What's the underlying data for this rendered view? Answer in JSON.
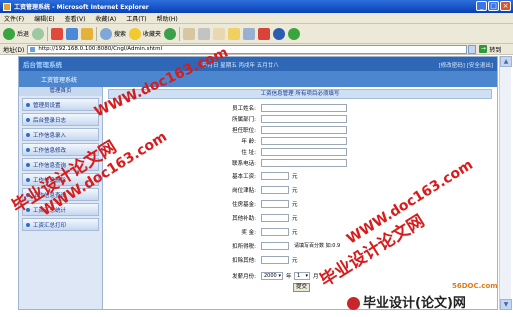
{
  "window": {
    "title": "工资管理系统 - Microsoft Internet Explorer",
    "buttons": [
      "_",
      "□",
      "×"
    ]
  },
  "menubar": [
    "文件(F)",
    "编辑(E)",
    "查看(V)",
    "收藏(A)",
    "工具(T)",
    "帮助(H)"
  ],
  "toolbar": {
    "back_label": "后退",
    "search_label": "搜索",
    "favorites_label": "收藏夹"
  },
  "address": {
    "label": "地址(D)",
    "url": "http://192.168.0.100:8080/Cngl/Admin.shtml",
    "go_label": "转到"
  },
  "app": {
    "logo": "后台管理系统",
    "date_text": "年月日  星期五  丙戌年  五月廿八",
    "header_links": "[修改密码] [安全退出]",
    "system_name": "工资管理系统"
  },
  "sidebar": {
    "heading": "管理首页",
    "items": [
      "管理员设置",
      "后台登录日志",
      "工作信息录入",
      "工作信息修改",
      "工作信息查询",
      "工作信息删除",
      "工作信息查询",
      "工资汇总统计",
      "工资汇总打印"
    ]
  },
  "form": {
    "title": "工资信息管理  所有项目必须填写",
    "fields": [
      {
        "label": "员工姓名:",
        "value": ""
      },
      {
        "label": "所属部门:",
        "value": ""
      },
      {
        "label": "担任职位:",
        "value": ""
      },
      {
        "label": "年    龄:",
        "value": ""
      },
      {
        "label": "住    址:",
        "value": ""
      },
      {
        "label": "联系电话:",
        "value": ""
      },
      {
        "label": "基本工资:",
        "value": "",
        "unit": "元"
      },
      {
        "label": "岗位津贴:",
        "value": "",
        "unit": "元"
      },
      {
        "label": "住房基金:",
        "value": "",
        "unit": "元"
      },
      {
        "label": "其他补助:",
        "value": "",
        "unit": "元"
      },
      {
        "label": "奖    金:",
        "value": "",
        "unit": "元"
      },
      {
        "label": "扣所得税:",
        "value": "",
        "hint": "请填写百分数 如:0.9"
      },
      {
        "label": "扣除其他:",
        "value": "",
        "unit": "元"
      }
    ],
    "pay_date": {
      "label": "发薪月份:",
      "year": "2000",
      "year_unit": "年",
      "month": "1",
      "month_unit": "月"
    },
    "submit_label": "提交"
  },
  "watermarks": {
    "left_cn": "毕业设计论文网",
    "left_url": "WWW.doc163.com",
    "right_cn": "毕业设计论文网",
    "right_url": "WWW.doc163.com",
    "center_url": "WWW.doc163.com",
    "bottom_logo": "毕业设计(论文)网",
    "site_mark": "56DOC.com"
  }
}
